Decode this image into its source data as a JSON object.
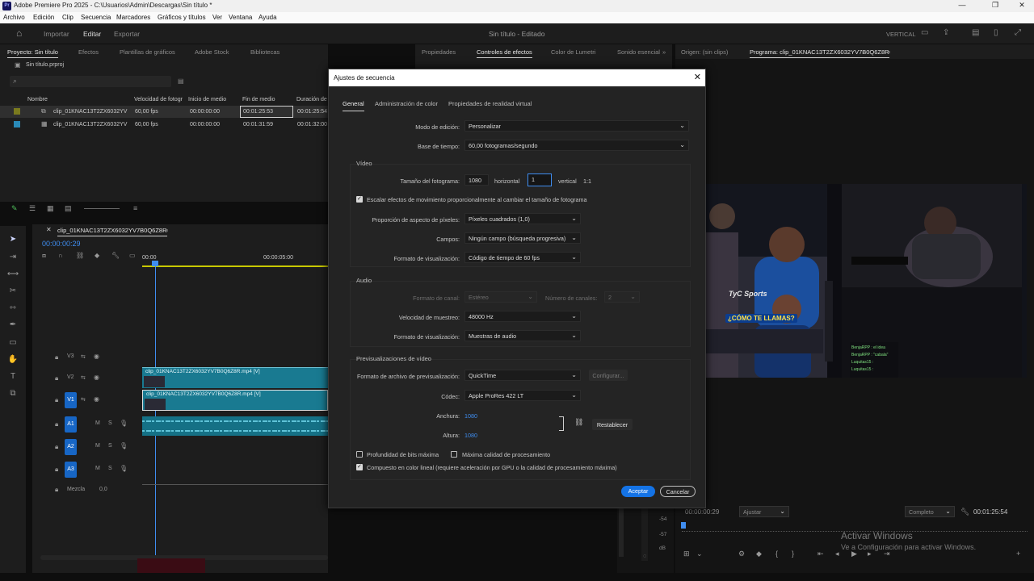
{
  "window": {
    "title": "Adobe Premiere Pro 2025 - C:\\Usuarios\\Admin\\Descargas\\Sin título *",
    "app_icon": "Pr"
  },
  "menu": [
    "Archivo",
    "Edición",
    "Clip",
    "Secuencia",
    "Marcadores",
    "Gráficos y títulos",
    "Ver",
    "Ventana",
    "Ayuda"
  ],
  "workspace": {
    "import": "Importar",
    "edit": "Editar",
    "export": "Exportar",
    "doc_title": "Sin título - Editado",
    "layout": "VERTICAL"
  },
  "project": {
    "tabs": [
      "Proyecto: Sin título",
      "Efectos",
      "Plantillas de gráficos",
      "Adobe Stock",
      "Bibliotecas"
    ],
    "file": "Sin título.prproj",
    "columns": [
      "Nombre",
      "Velocidad de fotogr",
      "Inicio de medio",
      "Fin de medio",
      "Duración de"
    ],
    "rows": [
      {
        "name": "clip_01KNAC13T2ZX6032YV",
        "fps": "60,00 fps",
        "start": "00:00:00:00",
        "end": "00:01:25:53",
        "dur": "00:01:25:54",
        "color": "#7a7a1e"
      },
      {
        "name": "clip_01KNAC13T2ZX6032YV",
        "fps": "60,00 fps",
        "start": "00:00:00:00",
        "end": "00:01:31:59",
        "dur": "00:01:32:00",
        "color": "#2a8ab8"
      }
    ]
  },
  "effects_panel": {
    "tabs": [
      "Propiedades",
      "Controles de efectos",
      "Color de Lumetri",
      "Sonido esencial"
    ]
  },
  "program": {
    "tabs": [
      "Origen: (sin clips)",
      "Programa: clip_01KNAC13T2ZX6032YV7B0Q6Z8R"
    ],
    "timecode_left": "00:00:00:29",
    "fit": "Ajustar",
    "quality": "Completo",
    "timecode_right": "00:01:25:54"
  },
  "timeline": {
    "tab": "clip_01KNAC13T2ZX6032YV7B0Q6Z8R",
    "timecode": "00:00:00:29",
    "ruler": [
      "00:00",
      "00:00:05:00"
    ],
    "tracks_video": [
      "V3",
      "V2",
      "V1"
    ],
    "tracks_audio": [
      "A1",
      "A2",
      "A3"
    ],
    "mix_label": "Mezcla",
    "mix_value": "0,0",
    "clip_v2": "clip_01KNAC13T2ZX6032YV7B0Q6Z8R.mp4 [V]",
    "clip_v1": "clip_01KNAC13T2ZX6032YV7B0Q6Z8R.mp4 [V]",
    "meter": [
      "-54",
      "-57",
      "dB"
    ]
  },
  "dialog": {
    "title": "Ajustes de secuencia",
    "tabs": [
      "General",
      "Administración de color",
      "Propiedades de realidad virtual"
    ],
    "editing_mode_label": "Modo de edición:",
    "editing_mode": "Personalizar",
    "timebase_label": "Base de tiempo:",
    "timebase": "60,00  fotogramas/segundo",
    "video_section": "Vídeo",
    "frame_size_label": "Tamaño del fotograma:",
    "frame_w": "1080",
    "horizontal": "horizontal",
    "frame_h": "1",
    "vertical": "vertical",
    "ratio": "1:1",
    "scale_motion": "Escalar efectos de movimiento proporcionalmente al cambiar el tamaño de fotograma",
    "par_label": "Proporción de aspecto de píxeles:",
    "par": "Píxeles cuadrados (1,0)",
    "fields_label": "Campos:",
    "fields": "Ningún campo (búsqueda progresiva)",
    "disp_label": "Formato de visualización:",
    "disp": "Código de tiempo de 60 fps",
    "audio_section": "Audio",
    "chan_fmt_label": "Formato de canal:",
    "chan_fmt": "Estéreo",
    "chan_count_label": "Número de canales:",
    "chan_count": "2",
    "sample_label": "Velocidad de muestreo:",
    "sample": "48000 Hz",
    "adisp_label": "Formato de visualización:",
    "adisp": "Muestras de audio",
    "preview_section": "Previsualizaciones de vídeo",
    "pv_fmt_label": "Formato de archivo de previsualización:",
    "pv_fmt": "QuickTime",
    "configure": "Configurar...",
    "codec_label": "Códec:",
    "codec": "Apple ProRes 422 LT",
    "width_label": "Anchura:",
    "width": "1080",
    "height_label": "Altura:",
    "height": "1080",
    "reset": "Restablecer",
    "max_bit": "Profundidad de bits máxima",
    "max_quality": "Máxima calidad de procesamiento",
    "linear": "Compuesto en color lineal (requiere aceleración por GPU o la calidad de procesamiento máxima)",
    "ok": "Aceptar",
    "cancel": "Cancelar"
  },
  "video": {
    "caption": "¿CÓMO TE LLAMAS?",
    "brand": "TyC Sports",
    "chat": [
      "BenjaRPP : el idea",
      "BenjaRPP : \"cabala\"",
      "Luquitas15 :",
      "Luquitas15 :"
    ]
  },
  "watermark": {
    "line1": "Activar Windows",
    "line2": "Ve a Configuración para activar Windows."
  }
}
